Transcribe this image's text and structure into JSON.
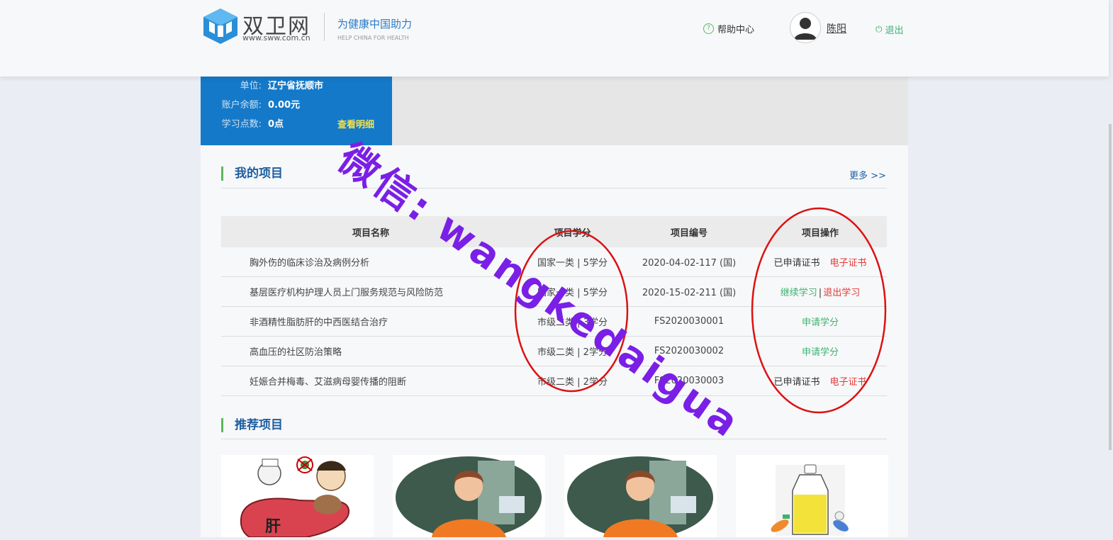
{
  "header": {
    "logo_text": "双卫网",
    "logo_url": "www.sww.com.cn",
    "slogan": "为健康中国助力",
    "slogan_en": "HELP CHINA FOR HEALTH",
    "help_label": "帮助中心",
    "username": "陈阳",
    "logout_label": "退出"
  },
  "user_panel": {
    "unit_label": "单位:",
    "unit_value": "辽宁省抚顺市",
    "balance_label": "账户余额:",
    "balance_value": "0.00元",
    "points_label": "学习点数:",
    "points_value": "0点",
    "detail_link": "查看明细"
  },
  "my_projects": {
    "title": "我的项目",
    "more": "更多 >>",
    "columns": [
      "项目名称",
      "项目学分",
      "项目编号",
      "项目操作"
    ],
    "rows": [
      {
        "name": "胸外伤的临床诊治及病例分析",
        "credit": "国家一类 | 5学分",
        "code": "2020-04-02-117 (国)",
        "status": "已申请证书",
        "action": "电子证书"
      },
      {
        "name": "基层医疗机构护理人员上门服务规范与风险防范",
        "credit": "国家一类 | 5学分",
        "code": "2020-15-02-211 (国)",
        "action_a": "继续学习",
        "action_sep": "|",
        "action_b": "退出学习"
      },
      {
        "name": "非酒精性脂肪肝的中西医结合治疗",
        "credit": "市级二类 | 3学分",
        "code": "FS2020030001",
        "action": "申请学分"
      },
      {
        "name": "高血压的社区防治策略",
        "credit": "市级二类 | 2学分",
        "code": "FS2020030002",
        "action": "申请学分"
      },
      {
        "name": "妊娠合并梅毒、艾滋病母婴传播的阻断",
        "credit": "市级二类 | 2学分",
        "code": "FS2020030003",
        "status": "已申请证书",
        "action": "电子证书"
      }
    ]
  },
  "recommended": {
    "title": "推荐项目",
    "liver_label": "肝"
  },
  "watermark": "微信: wangkedaigua",
  "colors": {
    "brand_blue": "#1479c9",
    "title_blue": "#1e5e9f",
    "accent_green": "#3cb371",
    "action_red": "#e53935",
    "watermark_purple": "#7a1fe6",
    "circle_red": "#dd1111"
  }
}
